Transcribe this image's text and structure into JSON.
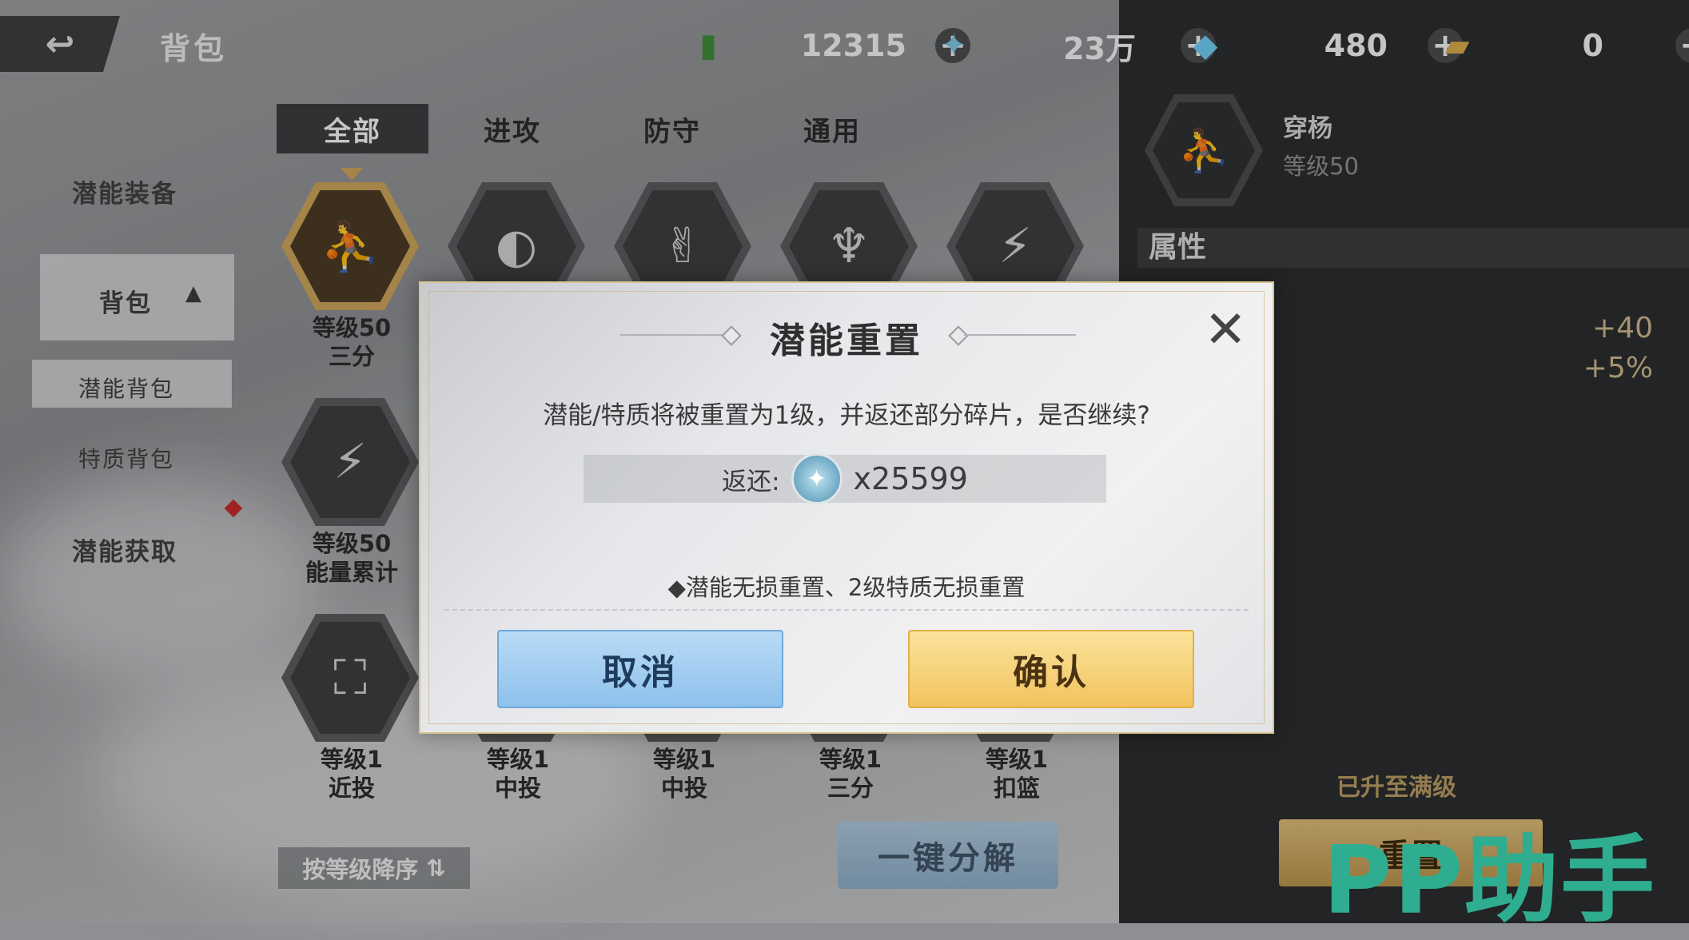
{
  "header": {
    "back_label": "↩",
    "title": "背包",
    "currencies": [
      {
        "icon": "cash-icon",
        "value": "12315"
      },
      {
        "icon": "crystal-shard-icon",
        "value": "23万"
      },
      {
        "icon": "diamond-icon",
        "value": "480"
      },
      {
        "icon": "card-icon",
        "value": "0"
      }
    ],
    "plus": "+"
  },
  "sidebar": {
    "items": [
      {
        "label": "潜能装备"
      },
      {
        "label": "背包"
      },
      {
        "label": "潜能背包"
      },
      {
        "label": "特质背包"
      },
      {
        "label": "潜能获取"
      }
    ]
  },
  "tabs": [
    {
      "label": "全部"
    },
    {
      "label": "进攻"
    },
    {
      "label": "防守"
    },
    {
      "label": "通用"
    }
  ],
  "grid": {
    "items": [
      {
        "level": "等级50",
        "name": "三分"
      },
      {
        "level": "",
        "name": ""
      },
      {
        "level": "",
        "name": ""
      },
      {
        "level": "",
        "name": ""
      },
      {
        "level": "",
        "name": ""
      },
      {
        "level": "等级50",
        "name": "能量累计"
      },
      {
        "level": "等级1",
        "name": "近投"
      },
      {
        "level": "等级1",
        "name": "中投"
      },
      {
        "level": "等级1",
        "name": "中投"
      },
      {
        "level": "等级1",
        "name": "三分"
      },
      {
        "level": "等级1",
        "name": "扣篮"
      }
    ]
  },
  "sort_label": "按等级降序",
  "decompose_label": "一键分解",
  "detail": {
    "name": "穿杨",
    "level": "等级50",
    "attr_header": "属性",
    "values": [
      "+40",
      "+5%"
    ],
    "max_text": "已升至满级",
    "reset_label": "重置"
  },
  "watermark": "PP助手",
  "dialog": {
    "title": "潜能重置",
    "message": "潜能/特质将被重置为1级，并返还部分碎片，是否继续?",
    "return_label": "返还:",
    "return_value": "x25599",
    "note": "◆潜能无损重置、2级特质无损重置",
    "cancel_label": "取消",
    "confirm_label": "确认",
    "close_label": "✕"
  }
}
